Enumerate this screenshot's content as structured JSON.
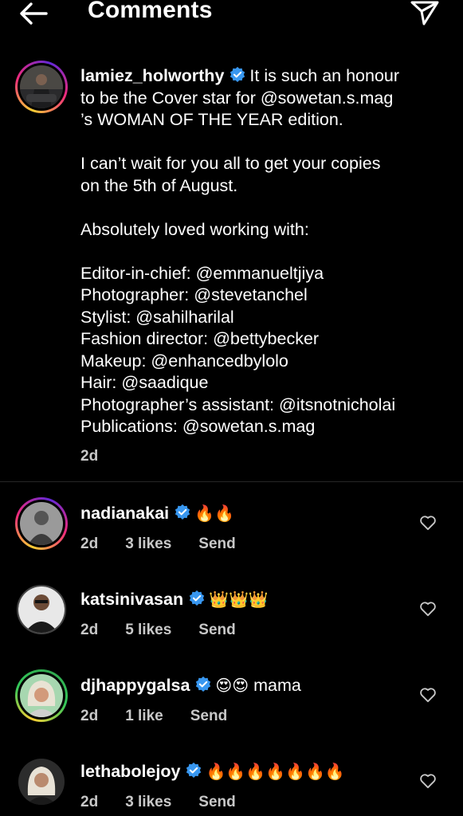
{
  "header": {
    "title": "Comments"
  },
  "caption": {
    "username": "lamiez_holworthy",
    "lines": [
      "It is such an honour",
      "to be the Cover star for @sowetan.s.mag",
      "’s WOMAN OF THE YEAR edition.",
      "",
      "I can’t wait for you all to get your copies",
      "on the 5th of August.",
      "",
      "Absolutely loved working with:",
      "",
      "Editor-in-chief: @emmanueltjiya",
      "Photographer: @stevetanchel",
      "Stylist: @sahilharilal",
      "Fashion director: @bettybecker",
      "Makeup: @enhancedbylolo",
      "Hair: @saadique",
      "Photographer’s assistant: @itsnotnicholai",
      "Publications: @sowetan.s.mag"
    ],
    "time": "2d"
  },
  "comments": [
    {
      "username": "nadianakai",
      "text": "",
      "emoji": "🔥🔥",
      "time": "2d",
      "likes": "3 likes",
      "send": "Send"
    },
    {
      "username": "katsinivasan",
      "text": "",
      "emoji": "👑👑👑",
      "time": "2d",
      "likes": "5 likes",
      "send": "Send"
    },
    {
      "username": "djhappygalsa",
      "text": "mama",
      "emoji": "😍😍",
      "time": "2d",
      "likes": "1 like",
      "send": "Send"
    },
    {
      "username": "lethabolejoy",
      "text": "",
      "emoji": "🔥🔥🔥🔥🔥🔥🔥",
      "time": "2d",
      "likes": "3 likes",
      "send": "Send"
    }
  ],
  "icons": {
    "back": "arrow-left-icon",
    "share": "paper-plane-icon",
    "verified": "verified-badge-icon",
    "heart": "heart-outline-icon"
  },
  "colors": {
    "background": "#000000",
    "text": "#ffffff",
    "meta": "#c8c8c8",
    "verified": "#3897f0"
  }
}
